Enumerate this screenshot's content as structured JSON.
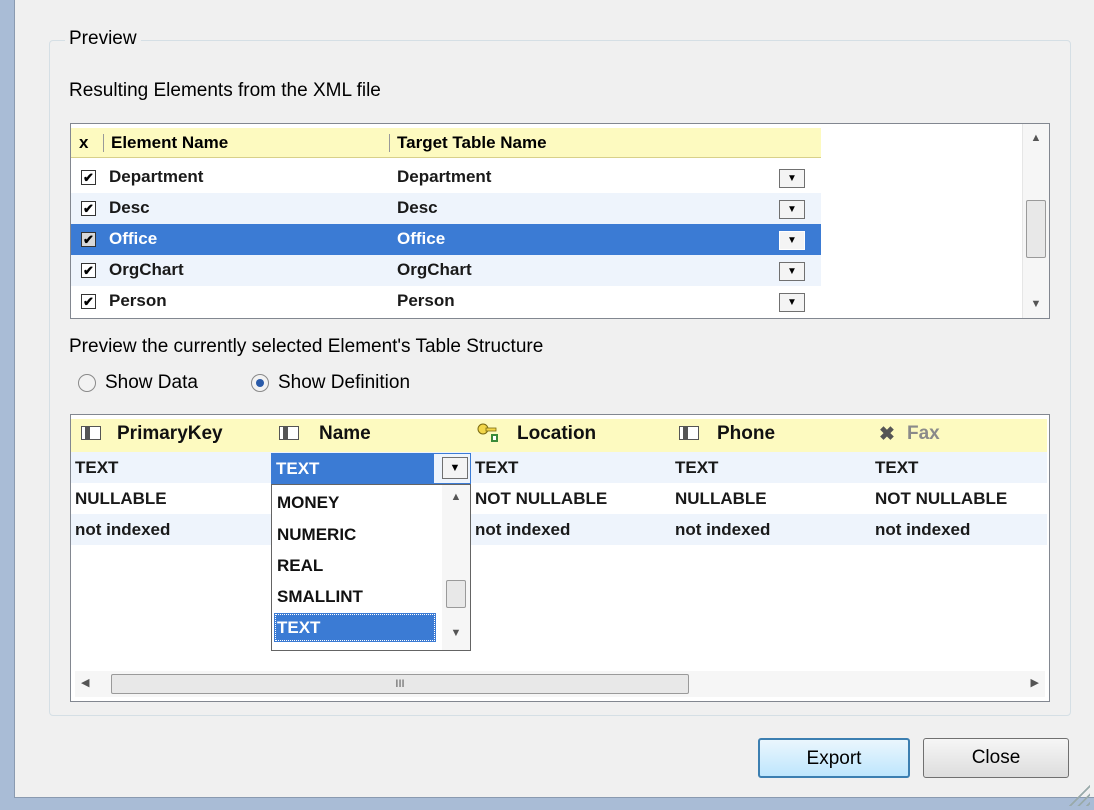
{
  "group_title": "Preview",
  "elements_label": "Resulting Elements from the XML file",
  "elements_grid": {
    "columns": [
      "x",
      "Element Name",
      "Target Table Name"
    ],
    "rows": [
      {
        "checked": true,
        "element": "Department",
        "target": "Department",
        "selected": false
      },
      {
        "checked": true,
        "element": "Desc",
        "target": "Desc",
        "selected": false
      },
      {
        "checked": true,
        "element": "Office",
        "target": "Office",
        "selected": true
      },
      {
        "checked": true,
        "element": "OrgChart",
        "target": "OrgChart",
        "selected": false
      },
      {
        "checked": true,
        "element": "Person",
        "target": "Person",
        "selected": false
      }
    ]
  },
  "structure_label": "Preview the currently selected Element's Table Structure",
  "radio": {
    "show_data": "Show Data",
    "show_definition": "Show Definition",
    "selected": "show_definition"
  },
  "definition_grid": {
    "columns": [
      {
        "name": "PrimaryKey",
        "icon": "column-icon"
      },
      {
        "name": "Name",
        "icon": "column-icon"
      },
      {
        "name": "Location",
        "icon": "key-icon"
      },
      {
        "name": "Phone",
        "icon": "column-icon"
      },
      {
        "name": "Fax",
        "icon": "excluded-icon"
      }
    ],
    "rows": [
      [
        "TEXT",
        "TEXT",
        "TEXT",
        "TEXT",
        "TEXT"
      ],
      [
        "NULLABLE",
        "",
        "NOT NULLABLE",
        "NULLABLE",
        "NOT NULLABLE"
      ],
      [
        "not indexed",
        "",
        "not indexed",
        "not indexed",
        "not indexed"
      ]
    ],
    "type_combo": {
      "value": "TEXT",
      "options": [
        "MONEY",
        "NUMERIC",
        "REAL",
        "SMALLINT",
        "TEXT"
      ],
      "selected_option": "TEXT"
    },
    "hscroll_grip": "III"
  },
  "buttons": {
    "export": "Export",
    "close": "Close"
  },
  "colors": {
    "selection": "#3b7bd4",
    "header": "#fdfac0",
    "alt_row": "#eef4fc"
  }
}
